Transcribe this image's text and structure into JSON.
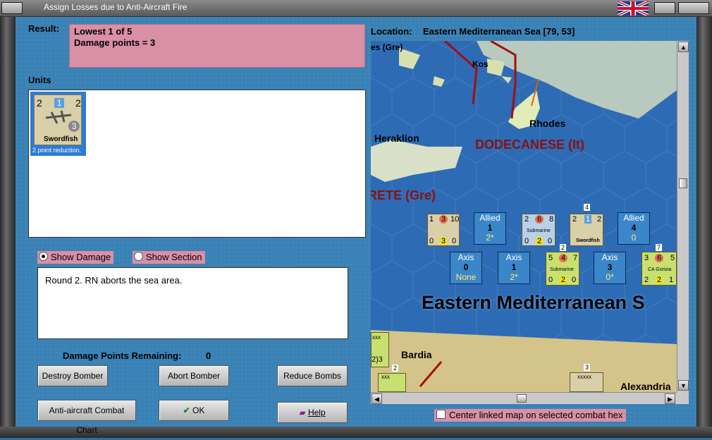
{
  "window": {
    "title": "Assign Losses due to Anti-Aircraft Fire"
  },
  "result": {
    "label": "Result:",
    "line1": "Lowest 1 of 5",
    "line2": "Damage points = 3"
  },
  "units": {
    "label": "Units",
    "items": [
      {
        "name": "Swordfish",
        "attack": "2",
        "defense": "2",
        "range": "1",
        "move": "3",
        "note": "2 point reduction."
      }
    ]
  },
  "view_options": {
    "show_damage": "Show Damage",
    "show_section": "Show Section",
    "selected": "show_damage"
  },
  "log": {
    "text": "Round 2.  RN aborts the sea area."
  },
  "damage_remaining": {
    "label": "Damage Points Remaining:",
    "value": "0"
  },
  "buttons": {
    "destroy_bomber": "Destroy Bomber",
    "abort_bomber": "Abort Bomber",
    "reduce_bombs": "Reduce Bombs",
    "aa_chart": "Anti-aircraft Combat Chart",
    "ok": "OK",
    "help": "Help"
  },
  "location": {
    "label": "Location:",
    "value": "Eastern Mediterranean Sea [79, 53]"
  },
  "map": {
    "labels": {
      "gre_top": "es (Gre)",
      "kos": "Kos",
      "rhodes": "Rhodes",
      "heraklion": "Heraklion",
      "dodecanese": "DODECANESE (It)",
      "crete": "RETE (Gre)",
      "sea": "Eastern Mediterranean S",
      "bardia": "Bardia",
      "alexandria": "Alexandria"
    },
    "allied_counters": [
      {
        "top": "1",
        "mid": "3",
        "right": "10",
        "b1": "0",
        "b2": "3",
        "b3": "0"
      },
      {
        "top": "2",
        "mid": "6",
        "right": "8",
        "name": "Submarine",
        "b1": "0",
        "b2": "2",
        "b3": "0"
      },
      {
        "top": "2",
        "mid": "1",
        "right": "2",
        "name": "Swordfish",
        "badge": "4"
      }
    ],
    "allied_summaries": [
      {
        "title": "Allied",
        "num": "1",
        "sub": "2*"
      },
      {
        "title": "Allied",
        "num": "4",
        "sub": "0"
      }
    ],
    "axis_summaries": [
      {
        "title": "Axis",
        "num": "0",
        "sub": "None"
      },
      {
        "title": "Axis",
        "num": "1",
        "sub": "2*"
      },
      {
        "title": "Axis",
        "num": "3",
        "sub": "0*"
      }
    ],
    "axis_counters": [
      {
        "top": "5",
        "mid": "4",
        "right": "7",
        "name": "Submarine",
        "b1": "0",
        "b2": "2",
        "b3": "0",
        "badge": "2"
      },
      {
        "top": "3",
        "mid": "6",
        "right": "5",
        "name": "CA Gorizia",
        "b1": "2",
        "b2": "2",
        "b3": "1",
        "badge": "7"
      }
    ],
    "misc": {
      "xxx": "xxx",
      "bottom_left": "2)3",
      "stack2": "2",
      "stack3": "3",
      "xxxxx": "xxxxx"
    },
    "colors": {
      "sea": "#2d6bb5",
      "land": "#cfe0b0",
      "axis_counter": "#c8e070",
      "allied_counter": "#d9cfa8"
    }
  },
  "center_link": {
    "label": "Center linked map on selected combat hex",
    "checked": false
  }
}
